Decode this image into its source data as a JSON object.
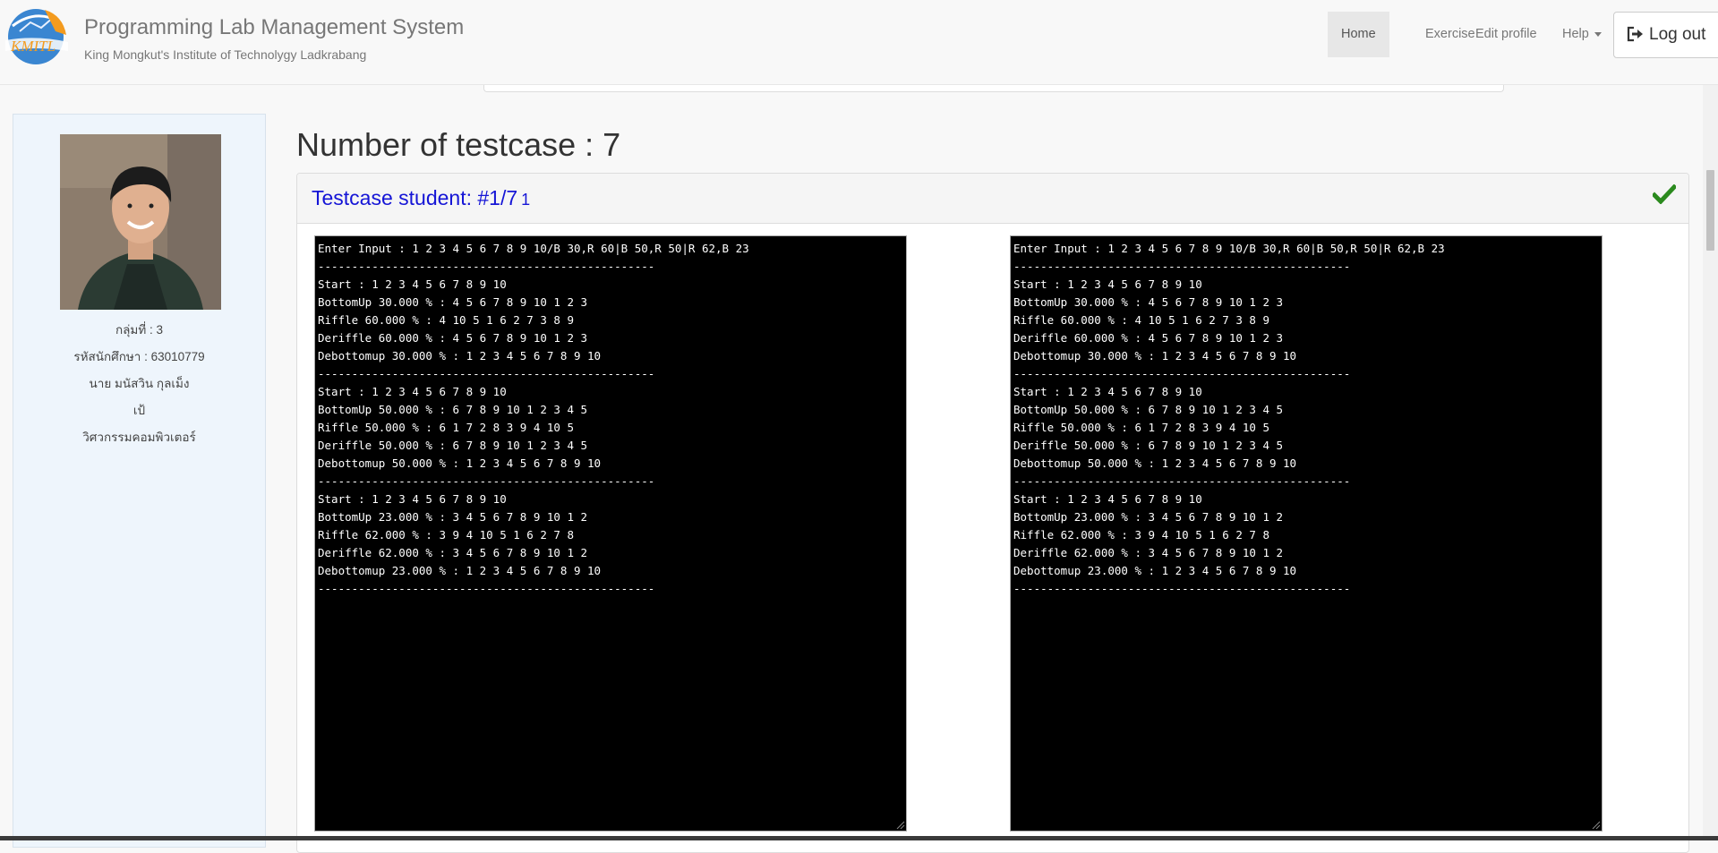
{
  "header": {
    "title": "Programming Lab Management System",
    "subtitle": "King Mongkut's Institute of Technolygy Ladkrabang",
    "logo_text": "KMITL"
  },
  "nav": {
    "home": "Home",
    "exercise": "Exercise",
    "edit_profile": "Edit profile",
    "help": "Help",
    "logout": "Log out"
  },
  "student": {
    "group": "กลุ่มที่ : 3",
    "student_id": "รหัสนักศึกษา : 63010779",
    "name": "นาย มนัสวิน กุลเม็ง",
    "nickname": "เป้",
    "department": "วิศวกรรมคอมพิวเตอร์"
  },
  "main": {
    "testcase_count": "Number of testcase : 7",
    "testcase_title": "Testcase student: #1/7",
    "testcase_number": "1"
  },
  "student_output": "Enter Input : 1 2 3 4 5 6 7 8 9 10/B 30,R 60|B 50,R 50|R 62,B 23\n--------------------------------------------------\nStart : 1 2 3 4 5 6 7 8 9 10\nBottomUp 30.000 % : 4 5 6 7 8 9 10 1 2 3\nRiffle 60.000 % : 4 10 5 1 6 2 7 3 8 9\nDeriffle 60.000 % : 4 5 6 7 8 9 10 1 2 3\nDebottomup 30.000 % : 1 2 3 4 5 6 7 8 9 10\n--------------------------------------------------\nStart : 1 2 3 4 5 6 7 8 9 10\nBottomUp 50.000 % : 6 7 8 9 10 1 2 3 4 5\nRiffle 50.000 % : 6 1 7 2 8 3 9 4 10 5\nDeriffle 50.000 % : 6 7 8 9 10 1 2 3 4 5\nDebottomup 50.000 % : 1 2 3 4 5 6 7 8 9 10\n--------------------------------------------------\nStart : 1 2 3 4 5 6 7 8 9 10\nBottomUp 23.000 % : 3 4 5 6 7 8 9 10 1 2\nRiffle 62.000 % : 3 9 4 10 5 1 6 2 7 8\nDeriffle 62.000 % : 3 4 5 6 7 8 9 10 1 2\nDebottomup 23.000 % : 1 2 3 4 5 6 7 8 9 10\n--------------------------------------------------",
  "expected_output": "Enter Input : 1 2 3 4 5 6 7 8 9 10/B 30,R 60|B 50,R 50|R 62,B 23\n--------------------------------------------------\nStart : 1 2 3 4 5 6 7 8 9 10\nBottomUp 30.000 % : 4 5 6 7 8 9 10 1 2 3\nRiffle 60.000 % : 4 10 5 1 6 2 7 3 8 9\nDeriffle 60.000 % : 4 5 6 7 8 9 10 1 2 3\nDebottomup 30.000 % : 1 2 3 4 5 6 7 8 9 10\n--------------------------------------------------\nStart : 1 2 3 4 5 6 7 8 9 10\nBottomUp 50.000 % : 6 7 8 9 10 1 2 3 4 5\nRiffle 50.000 % : 6 1 7 2 8 3 9 4 10 5\nDeriffle 50.000 % : 6 7 8 9 10 1 2 3 4 5\nDebottomup 50.000 % : 1 2 3 4 5 6 7 8 9 10\n--------------------------------------------------\nStart : 1 2 3 4 5 6 7 8 9 10\nBottomUp 23.000 % : 3 4 5 6 7 8 9 10 1 2\nRiffle 62.000 % : 3 9 4 10 5 1 6 2 7 8\nDeriffle 62.000 % : 3 4 5 6 7 8 9 10 1 2\nDebottomup 23.000 % : 1 2 3 4 5 6 7 8 9 10\n--------------------------------------------------",
  "icons": {
    "logo": "kmitl-logo-icon",
    "logout": "logout-icon",
    "check": "check-icon",
    "caret": "caret-down-icon"
  },
  "colors": {
    "check": "#2b8a1e",
    "testcase_title": "#1515d6",
    "terminal_bg": "#000000",
    "terminal_fg": "#ffffff"
  }
}
